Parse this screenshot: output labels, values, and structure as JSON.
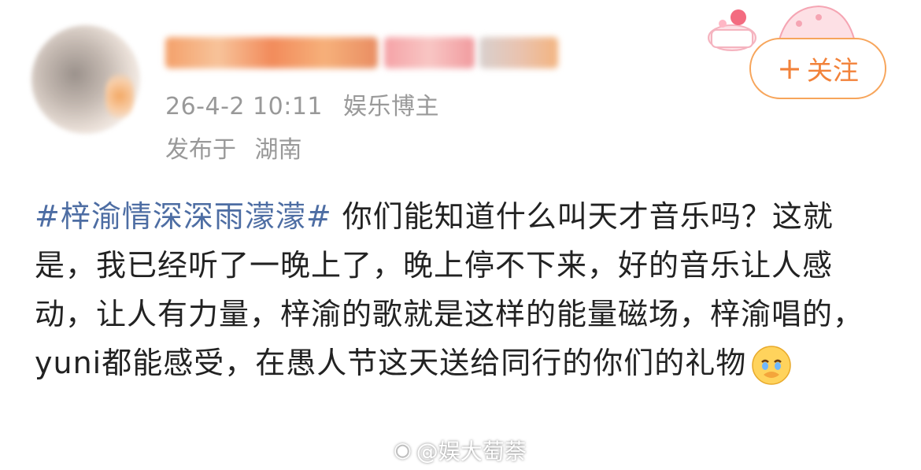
{
  "author": {
    "meta_date": "26-4-2 10:11",
    "meta_tag": "娱乐博主",
    "location_prefix": "发布于",
    "location": "湖南"
  },
  "follow": {
    "plus": "+",
    "label": "关注"
  },
  "post": {
    "hashtag": "#梓渝情深深雨濛濛#",
    "body": " 你们能知道什么叫天才音乐吗？这就是，我已经听了一晚上了，晚上停不下来，好的音乐让人感动，让人有力量，梓渝的歌就是这样的能量磁场，梓渝唱的，yuni都能感受，在愚人节这天送给同行的你们的礼物"
  },
  "watermark": {
    "icon": "weibo-icon",
    "text": "@娱大萄萘"
  },
  "colors": {
    "hashtag": "#4d6da3",
    "follow_border": "#f7a55b",
    "follow_text": "#f2823a",
    "meta": "#999999"
  }
}
